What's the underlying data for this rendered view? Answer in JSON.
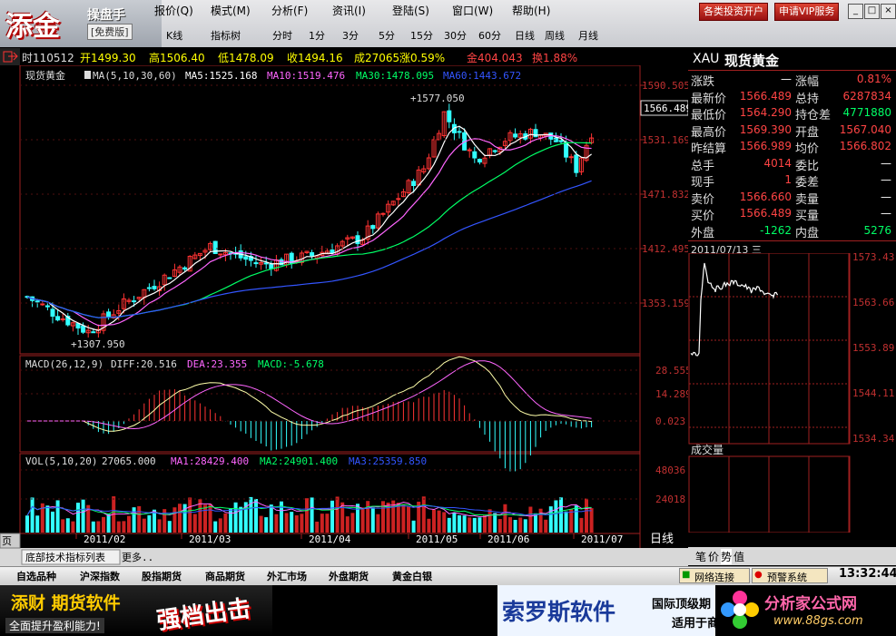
{
  "app": {
    "logo_big": "添金",
    "logo_name": "操盘手",
    "logo_free": "[免费版]"
  },
  "menu": [
    "报价(Q)",
    "模式(M)",
    "分析(F)",
    "资讯(I)",
    "登陆(S)",
    "窗口(W)",
    "帮助(H)"
  ],
  "top_buttons": {
    "open_account": "各类投资开户",
    "vip": "申请VIP服务"
  },
  "toolbar": [
    "K线",
    "指标树",
    "分时",
    "1分",
    "3分",
    "5分",
    "15分",
    "30分",
    "60分",
    "日线",
    "周线",
    "月线"
  ],
  "quote_bar": {
    "time": "时110512",
    "open": "开1499.30",
    "high": "高1506.40",
    "low": "低1478.09",
    "close": "收1494.16",
    "vol": "成27065",
    "rise": "涨0.59%",
    "gold": "金404.043",
    "swap": "换1.88%"
  },
  "main_chart": {
    "title": "现货黄金",
    "ma_label": "MA(5,10,30,60)",
    "ma5": "MA5:1525.168",
    "ma10": "MA10:1519.476",
    "ma30": "MA30:1478.095",
    "ma60": "MA60:1443.672",
    "high_label": "1577.050",
    "low_label": "1307.950",
    "price_tag": "1566.489",
    "y_ticks": [
      "1590.505",
      "1531.169",
      "1471.832",
      "1412.495",
      "1353.159"
    ],
    "colors": {
      "ma5": "#ffffff",
      "ma10": "#ff66ff",
      "ma30": "#00ff66",
      "ma60": "#3355ff",
      "up": "#ff3333",
      "down": "#33ffff"
    }
  },
  "macd": {
    "label": "MACD(26,12,9)",
    "diff": "DIFF:20.516",
    "dea": "DEA:23.355",
    "macd": "MACD:-5.678",
    "y_ticks": [
      "28.555",
      "14.289",
      "0.023"
    ]
  },
  "vol": {
    "label": "VOL(5,10,20)",
    "value": "27065.000",
    "ma1": "MA1:28429.400",
    "ma2": "MA2:24901.400",
    "ma3": "MA3:25359.850",
    "y_ticks": [
      "48036",
      "24018"
    ]
  },
  "x_axis": [
    "2011/02",
    "2011/03",
    "2011/04",
    "2011/05",
    "2011/06",
    "2011/07"
  ],
  "period_label": "日线",
  "bottom_bar": {
    "menu_btn": "页",
    "indicator_tab": "底部技术指标列表",
    "more": "更多.."
  },
  "quote_panel": {
    "symbol": "XAU",
    "name": "现货黄金",
    "rows": [
      {
        "l1": "涨跌",
        "v1": "—",
        "l2": "涨幅",
        "v2": "0.81%"
      },
      {
        "l1": "最新价",
        "v1": "1566.489",
        "l2": "总持",
        "v2": "6287834"
      },
      {
        "l1": "最低价",
        "v1": "1564.290",
        "l2": "持仓差",
        "v2": "4771880"
      },
      {
        "l1": "最高价",
        "v1": "1569.390",
        "l2": "开盘",
        "v2": "1567.040"
      },
      {
        "l1": "昨结算",
        "v1": "1566.989",
        "l2": "均价",
        "v2": "1566.802"
      },
      {
        "l1": "总手",
        "v1": "4014",
        "l2": "委比",
        "v2": "—"
      },
      {
        "l1": "现手",
        "v1": "1",
        "l2": "委差",
        "v2": "—"
      },
      {
        "l1": "卖价",
        "v1": "1566.660",
        "l2": "卖量",
        "v2": "—"
      },
      {
        "l1": "买价",
        "v1": "1566.489",
        "l2": "买量",
        "v2": "—"
      },
      {
        "l1": "外盘",
        "v1": "-1262",
        "l2": "内盘",
        "v2": "5276"
      }
    ],
    "date": "2011/07/13 三",
    "mini_ticks": [
      "1573.43",
      "1563.66",
      "1553.89",
      "1544.11",
      "1534.34"
    ],
    "volume_label": "成交量",
    "tabs": [
      "笔",
      "价",
      "势",
      "值"
    ]
  },
  "bottom_tabs": [
    "自选品种",
    "沪深指数",
    "股指期货",
    "商品期货",
    "外汇市场",
    "外盘期货",
    "黄金白银"
  ],
  "status": {
    "network": "网络连接",
    "alert": "预警系统",
    "clock": "13:32:44"
  },
  "ads": {
    "left_title": "添财 期货软件",
    "left_sub": "全面提升盈利能力!",
    "slogan": "强档出击",
    "mid_title": "索罗斯软件",
    "mid_sub1": "国际顶级期",
    "mid_sub2": "适用于商",
    "right_title": "分析家公式网",
    "right_url": "www.88gs.com"
  }
}
